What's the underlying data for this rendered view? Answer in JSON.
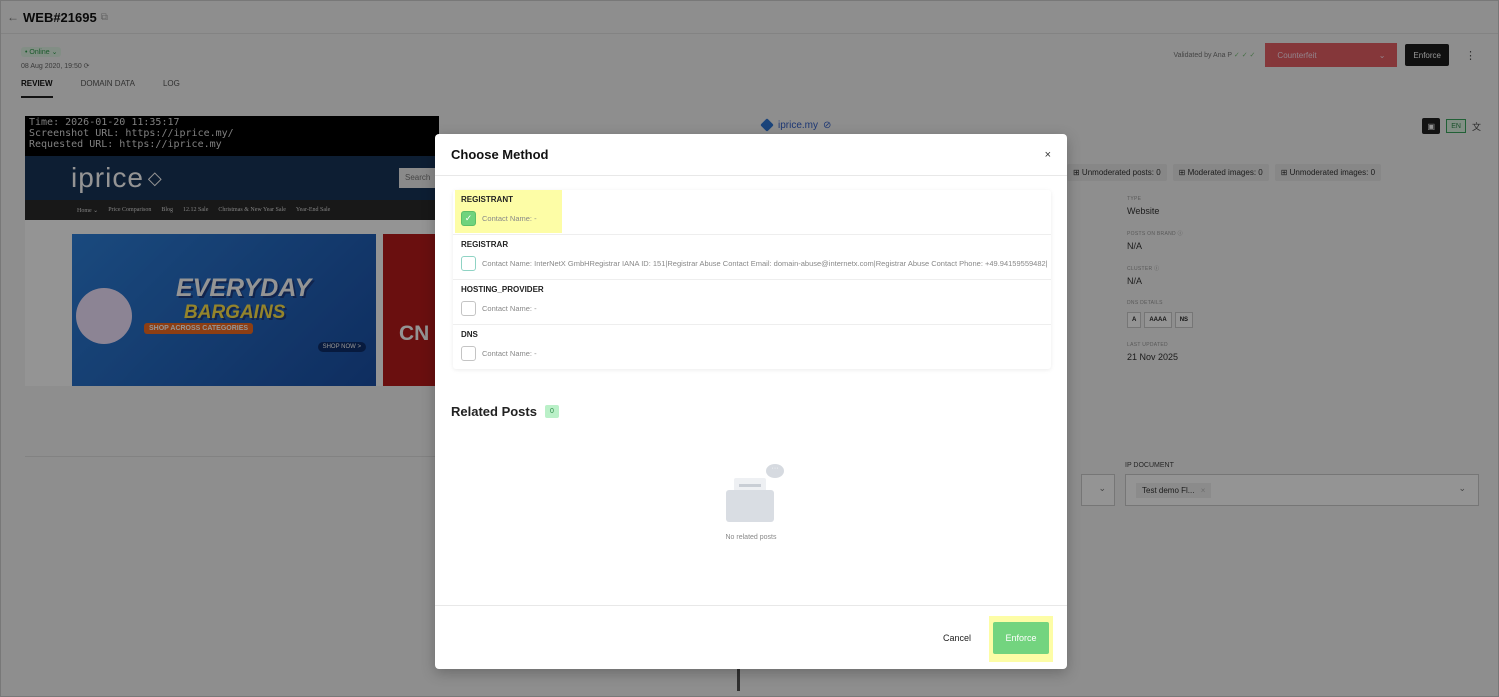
{
  "header": {
    "title": "WEB#21695"
  },
  "status": {
    "online": "• Online ⌄",
    "date": "08 Aug 2020, 19:50 ⟳"
  },
  "actions": {
    "validated_by": "Validated by Ana P",
    "validated_checks": "✓ ✓ ✓",
    "classification": "Counterfeit",
    "enforce_label": "Enforce"
  },
  "tabs": [
    {
      "label": "REVIEW"
    },
    {
      "label": "DOMAIN DATA"
    },
    {
      "label": "LOG"
    }
  ],
  "screenshot": {
    "time_line": "Time: 2026-01-20 11:35:17",
    "screenshot_url_line": "Screenshot URL: https://iprice.my/",
    "requested_url_line": "Requested URL: https://iprice.my",
    "logo": "iprice",
    "search_placeholder": "Search",
    "nav_items": [
      "Home ⌄",
      "Price Comparison",
      "Blog",
      "12.12 Sale",
      "Christmas & New Year Sale",
      "Year-End Sale"
    ],
    "banner_line1": "EVERYDAY",
    "banner_line2": "BARGAINS",
    "banner_tag": "SHOP ACROSS CATEGORIES",
    "banner_cta": "SHOP NOW >",
    "side_banner_text": "CN"
  },
  "domain": {
    "name": "iprice.my",
    "lang": "EN",
    "lang_alt": "文"
  },
  "stats": [
    "⊞ Unmoderated posts: 0",
    "⊞ Moderated images: 0",
    "⊞ Unmoderated images: 0"
  ],
  "info": {
    "type_label": "TYPE",
    "type_value": "Website",
    "posts_on_brand_label": "POSTS ON BRAND ⓘ",
    "posts_on_brand_value": "N/A",
    "cluster_label": "CLUSTER ⓘ",
    "cluster_value": "N/A",
    "dns_label": "DNS DETAILS",
    "dns_tags": [
      "A",
      "AAAA",
      "NS"
    ],
    "last_updated_label": "LAST UPDATED",
    "last_updated_value": "21 Nov 2025"
  },
  "ip_document": {
    "label": "IP DOCUMENT",
    "selected": "Test demo Fl...",
    "remove": "×"
  },
  "modal": {
    "title": "Choose Method",
    "close": "×",
    "methods": [
      {
        "name": "REGISTRANT",
        "contact": "Contact Name: -",
        "checked": true
      },
      {
        "name": "REGISTRAR",
        "contact": "Contact Name: InterNetX GmbHRegistrar IANA ID: 151|Registrar Abuse Contact Email: domain-abuse@internetx.com|Registrar Abuse Contact Phone: +49.94159559482|",
        "checked": false
      },
      {
        "name": "HOSTING_PROVIDER",
        "contact": "Contact Name: -",
        "checked": false
      },
      {
        "name": "DNS",
        "contact": "Contact Name: -",
        "checked": false
      }
    ],
    "related_title": "Related Posts",
    "related_count": "0",
    "empty_text": "No related posts",
    "cancel_label": "Cancel",
    "enforce_label": "Enforce"
  },
  "colors": {
    "accent_green": "#73d47f",
    "counterfeit_red": "#e3474c",
    "highlight_yellow": "#fdfda6"
  }
}
